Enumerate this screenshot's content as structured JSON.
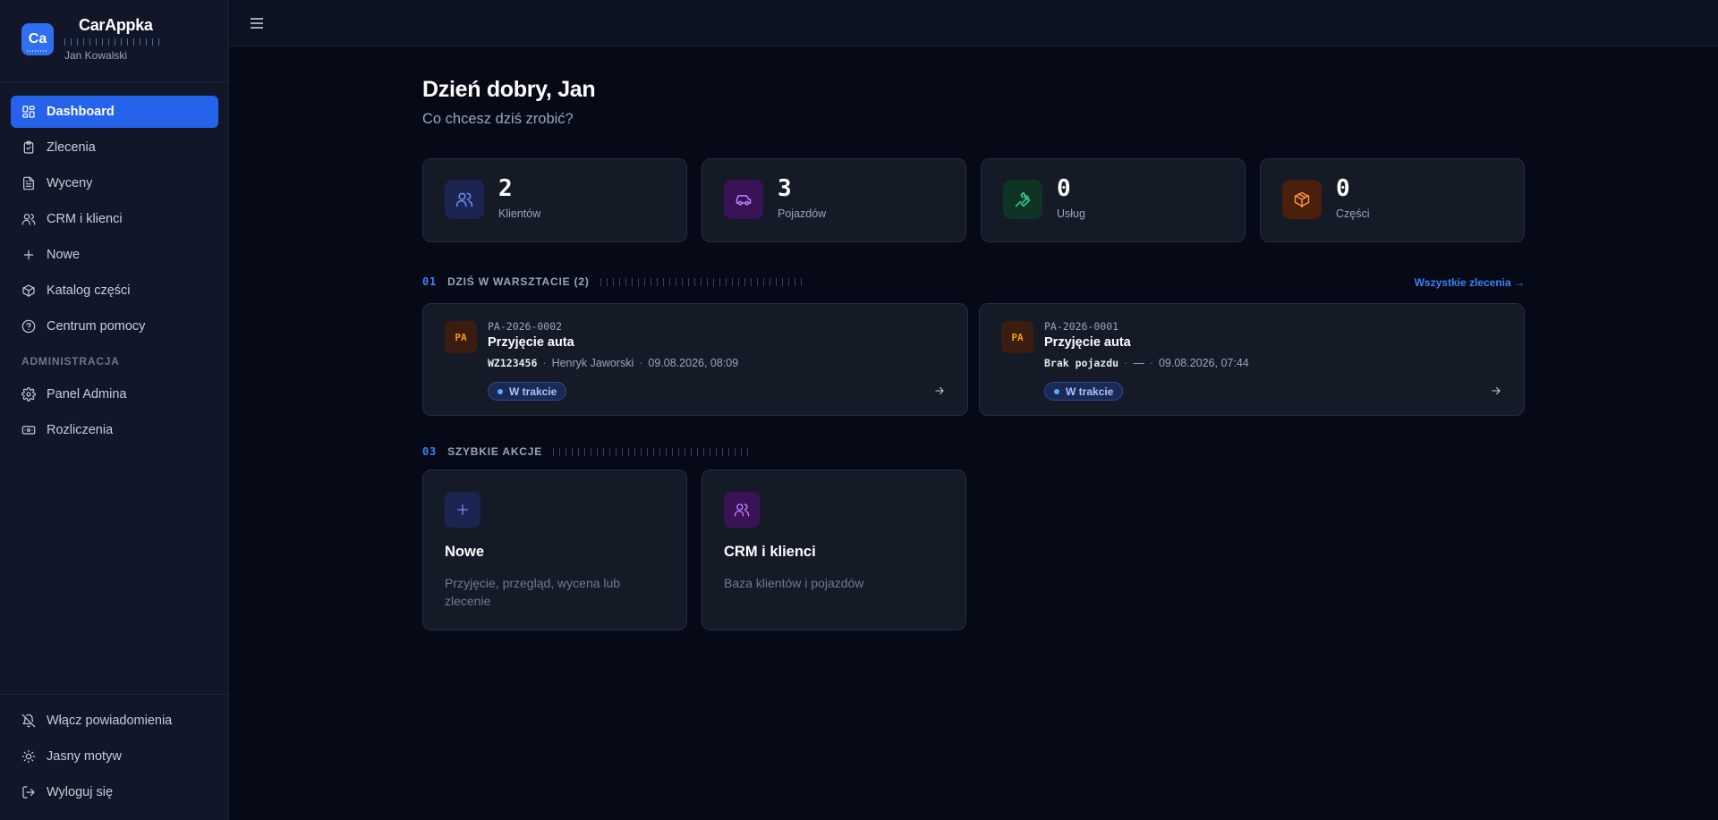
{
  "app": {
    "name": "CarAppka",
    "logo_text": "Ca",
    "user_name": "Jan Kowalski"
  },
  "sidebar": {
    "items": [
      {
        "label": "Dashboard",
        "icon": "dashboard-icon",
        "active": true
      },
      {
        "label": "Zlecenia",
        "icon": "clipboard-check-icon"
      },
      {
        "label": "Wyceny",
        "icon": "document-icon"
      },
      {
        "label": "CRM i klienci",
        "icon": "users-icon"
      },
      {
        "label": "Nowe",
        "icon": "plus-icon"
      },
      {
        "label": "Katalog części",
        "icon": "box-icon"
      },
      {
        "label": "Centrum pomocy",
        "icon": "help-circle-icon"
      }
    ],
    "admin_section_label": "ADMINISTRACJA",
    "admin_items": [
      {
        "label": "Panel Admina",
        "icon": "gear-icon"
      },
      {
        "label": "Rozliczenia",
        "icon": "banknote-icon"
      }
    ],
    "bottom_items": [
      {
        "label": "Włącz powiadomienia",
        "icon": "bell-off-icon"
      },
      {
        "label": "Jasny motyw",
        "icon": "sun-icon"
      },
      {
        "label": "Wyloguj się",
        "icon": "logout-icon"
      }
    ]
  },
  "main": {
    "greeting": "Dzień dobry, Jan",
    "subtitle": "Co chcesz dziś zrobić?",
    "stats": [
      {
        "value": "2",
        "label": "Klientów",
        "icon": "users-icon",
        "color": "#6d8cf0"
      },
      {
        "value": "3",
        "label": "Pojazdów",
        "icon": "car-icon",
        "color": "#c084fc"
      },
      {
        "value": "0",
        "label": "Usług",
        "icon": "wrench-icon",
        "color": "#34d399"
      },
      {
        "value": "0",
        "label": "Części",
        "icon": "package-icon",
        "color": "#fb923c"
      }
    ],
    "today": {
      "number": "01",
      "title": "DZIŚ W WARSZTACIE (2)",
      "link": "Wszystkie zlecenia →",
      "orders": [
        {
          "badge": "PA",
          "id": "PA-2026-0002",
          "title": "Przyjęcie auta",
          "plate": "WZ123456",
          "sep": "·",
          "client": "Henryk Jaworski",
          "date": "09.08.2026, 08:09",
          "status": "W trakcie"
        },
        {
          "badge": "PA",
          "id": "PA-2026-0001",
          "title": "Przyjęcie auta",
          "plate": "Brak pojazdu",
          "sep": "·",
          "client": "—",
          "date": "09.08.2026, 07:44",
          "status": "W trakcie"
        }
      ]
    },
    "quick": {
      "number": "03",
      "title": "SZYBKIE AKCJE",
      "actions": [
        {
          "title": "Nowe",
          "desc": "Przyjęcie, przegląd, wycena lub zlecenie",
          "icon": "plus-icon"
        },
        {
          "title": "CRM i klienci",
          "desc": "Baza klientów i pojazdów",
          "icon": "users-icon"
        }
      ]
    }
  },
  "colors": {
    "accent": "#2563eb",
    "status": "#60a5fa",
    "badge": "#f59e0b"
  }
}
